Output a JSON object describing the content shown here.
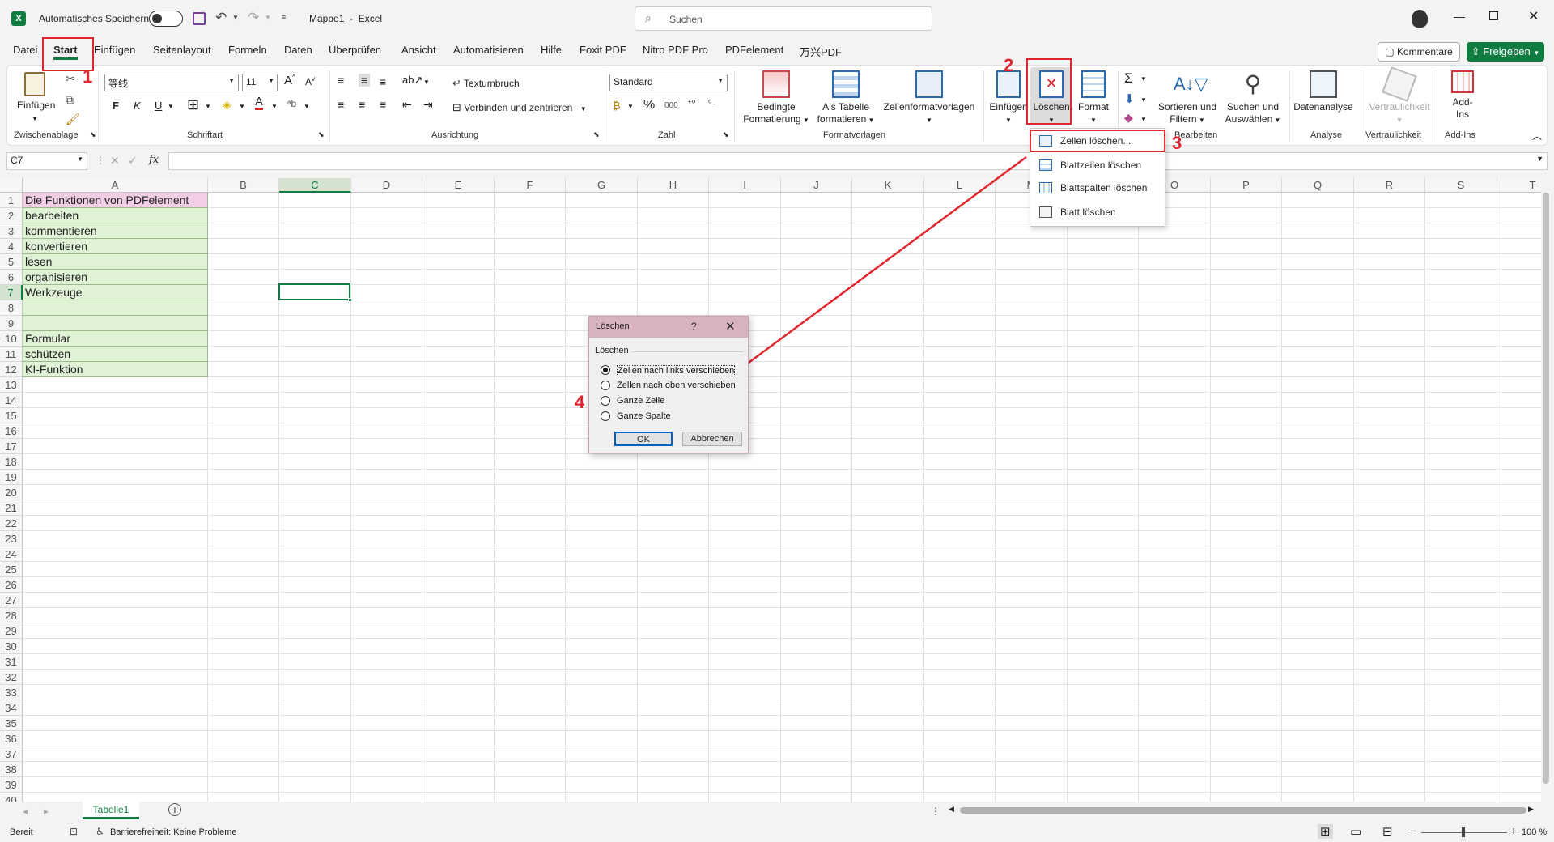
{
  "titlebar": {
    "autosave_label": "Automatisches Speichern",
    "file_title": "Mappe1  -  Excel",
    "search_placeholder": "Suchen"
  },
  "tabs": [
    "Datei",
    "Start",
    "Einfügen",
    "Seitenlayout",
    "Formeln",
    "Daten",
    "Überprüfen",
    "Ansicht",
    "Automatisieren",
    "Hilfe",
    "Foxit PDF",
    "Nitro PDF Pro",
    "PDFelement",
    "万兴PDF"
  ],
  "tab_right": {
    "comments": "Kommentare",
    "share": "Freigeben"
  },
  "ribbon": {
    "clipboard": {
      "paste": "Einfügen",
      "group": "Zwischenablage"
    },
    "font": {
      "name": "等线",
      "size": "11",
      "bold": "F",
      "italic": "K",
      "underline": "U",
      "group": "Schriftart"
    },
    "alignment": {
      "wrap": "Textumbruch",
      "merge": "Verbinden und zentrieren",
      "group": "Ausrichtung"
    },
    "number": {
      "format": "Standard",
      "percent": "%",
      "thousands": "000",
      "group": "Zahl"
    },
    "styles": {
      "conditional": "Bedingte",
      "conditional2": "Formatierung",
      "astable": "Als Tabelle",
      "astable2": "formatieren",
      "cellstyles": "Zellenformatvorlagen",
      "group": "Formatvorlagen"
    },
    "cells": {
      "insert": "Einfügen",
      "delete": "Löschen",
      "format": "Format"
    },
    "editing": {
      "sum": "Σ",
      "sort": "Sortieren und",
      "sort2": "Filtern",
      "find": "Suchen und",
      "find2": "Auswählen",
      "group": "Bearbeiten"
    },
    "analysis": {
      "label": "Datenanalyse",
      "group": "Analyse"
    },
    "sensitivity": {
      "label": "Vertraulichkeit",
      "group": "Vertraulichkeit"
    },
    "addins": {
      "label": "Add-",
      "label2": "Ins",
      "group": "Add-Ins"
    }
  },
  "delete_menu": [
    "Zellen löschen...",
    "Blattzeilen löschen",
    "Blattspalten löschen",
    "Blatt löschen"
  ],
  "formula_bar": {
    "namebox": "C7",
    "fx": "fx",
    "content": ""
  },
  "columns": [
    "A",
    "B",
    "C",
    "D",
    "E",
    "F",
    "G",
    "H",
    "I",
    "J",
    "K",
    "L",
    "M",
    "N",
    "O",
    "P",
    "Q",
    "R",
    "S",
    "T"
  ],
  "rows": [
    "1",
    "2",
    "3",
    "4",
    "5",
    "6",
    "7",
    "8",
    "9",
    "10",
    "11",
    "12",
    "13",
    "14",
    "15",
    "16",
    "17",
    "18",
    "19",
    "20",
    "21",
    "22",
    "23",
    "24",
    "25",
    "26",
    "27",
    "28",
    "29",
    "30",
    "31",
    "32",
    "33",
    "34",
    "35",
    "36",
    "37",
    "38",
    "39",
    "40"
  ],
  "cells_a": [
    "Die Funktionen von PDFelement",
    "bearbeiten",
    "kommentieren",
    "konvertieren",
    "lesen",
    "organisieren",
    "Werkzeuge",
    "",
    "",
    "Formular",
    "schützen",
    "KI-Funktion"
  ],
  "dialog": {
    "title": "Löschen",
    "help": "?",
    "section": "Löschen",
    "options": [
      "Zellen nach links verschieben",
      "Zellen nach oben verschieben",
      "Ganze Zeile",
      "Ganze Spalte"
    ],
    "selected_option": "Zellen nach links verschieben",
    "ok": "OK",
    "cancel": "Abbrechen"
  },
  "annotations": [
    "1",
    "2",
    "3",
    "4"
  ],
  "sheet_tab": "Tabelle1",
  "statusbar": {
    "ready": "Bereit",
    "accessibility": "Barrierefreiheit: Keine Probleme",
    "zoom": "100 %"
  },
  "colors": {
    "excel_green": "#107c41",
    "header_fill": "#f2cde6",
    "data_fill": "#dff2d6",
    "annotation_red": "#e0262e",
    "dialog_title": "#d8b3bf"
  }
}
